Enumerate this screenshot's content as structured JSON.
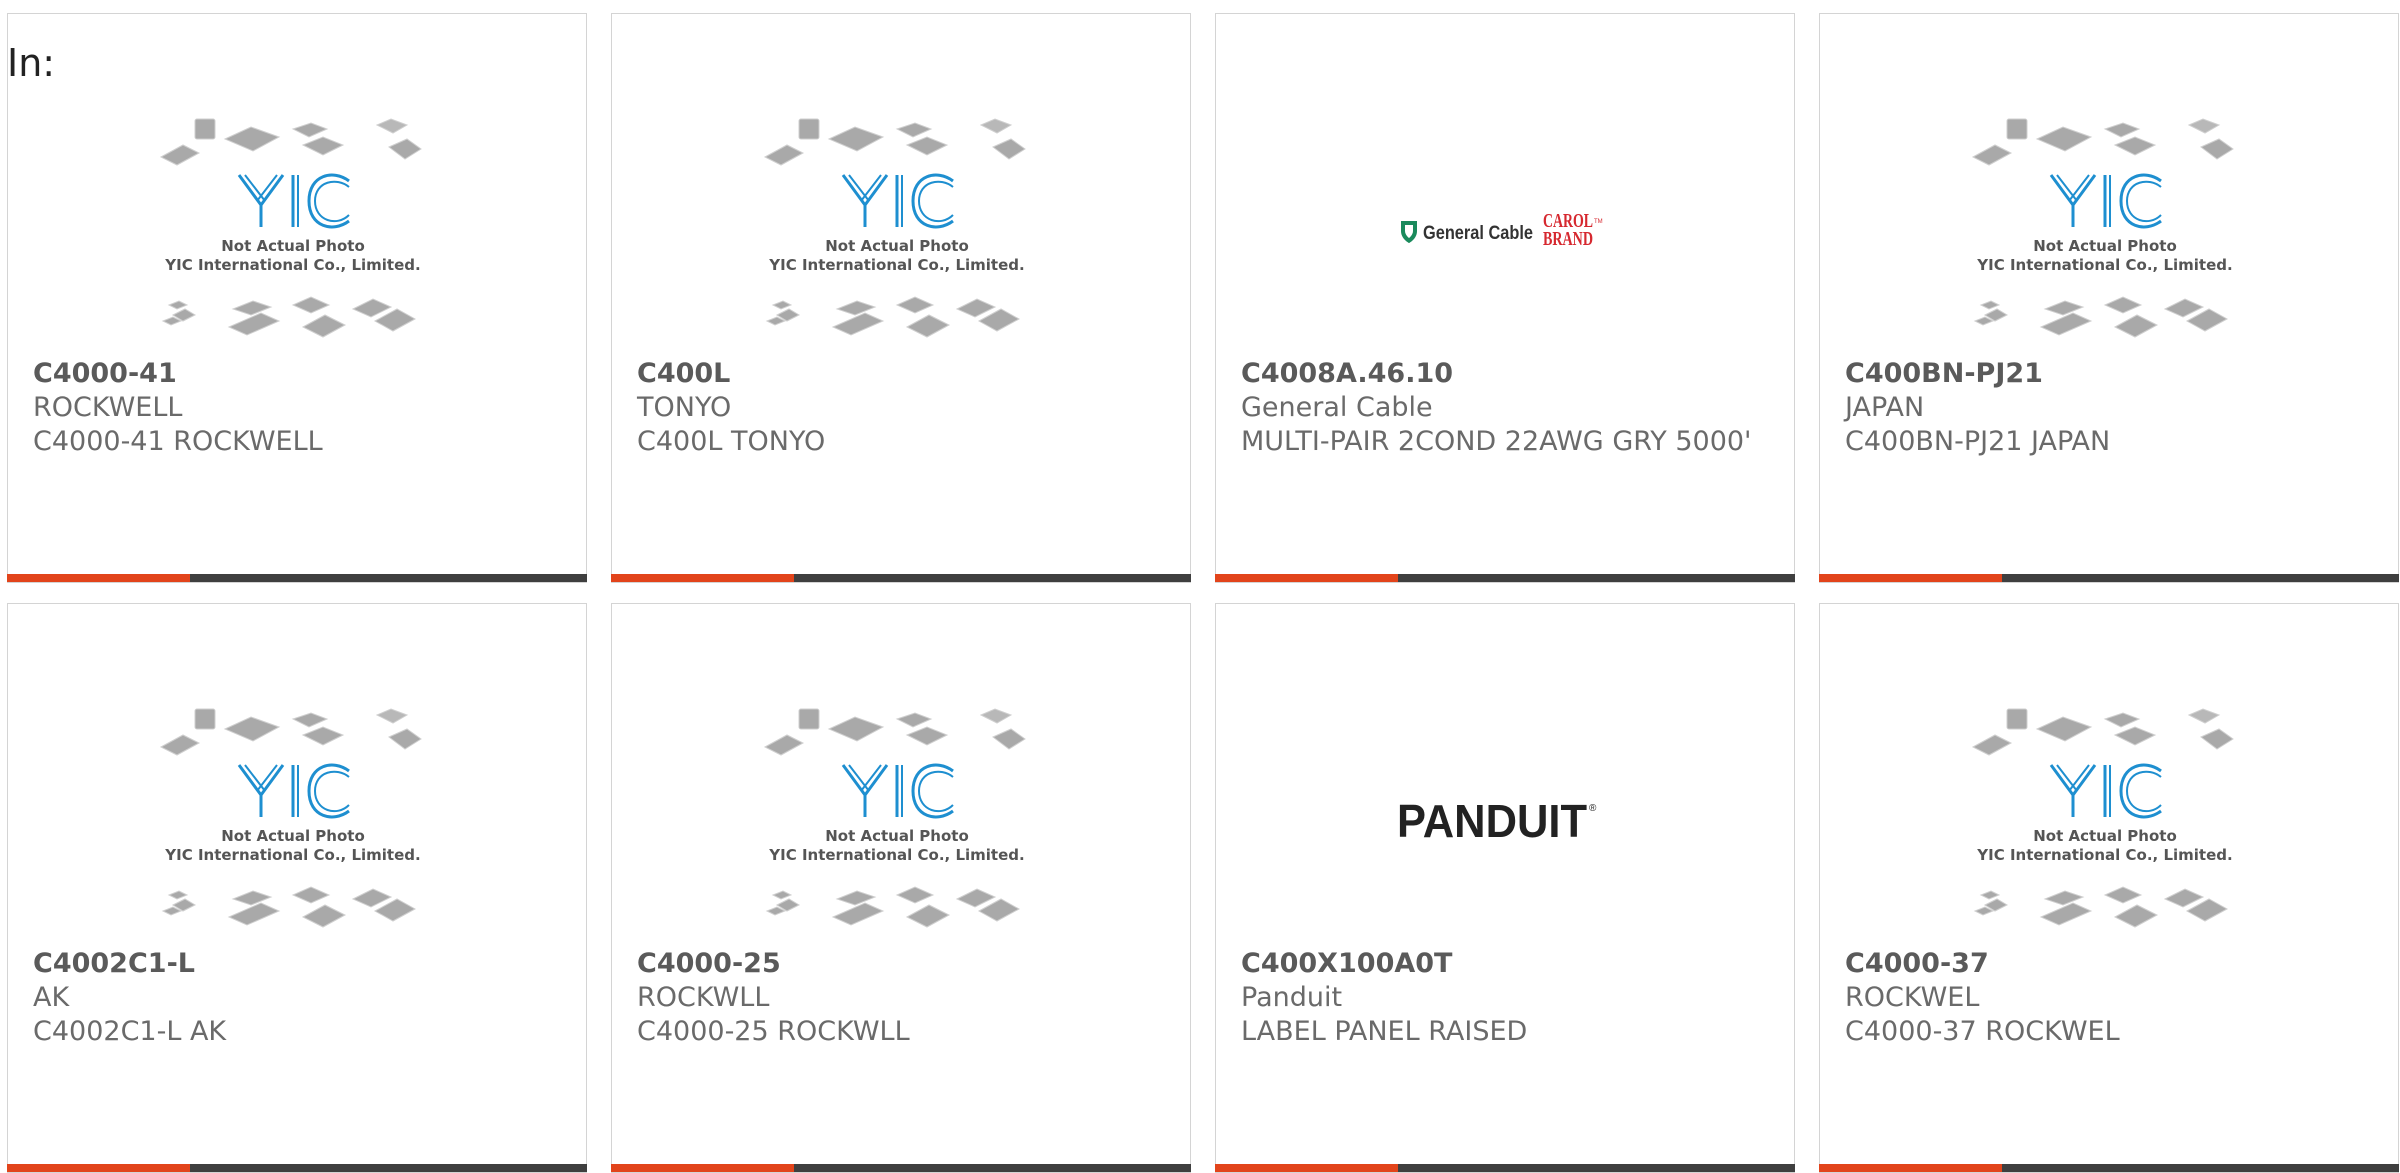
{
  "filter": {
    "label": "In:"
  },
  "colors": {
    "accent": "#e2441b",
    "bar": "#3f3f3f",
    "yic_blue": "#1e8fd0"
  },
  "placeholder": {
    "icon": "yic-logo-icon",
    "line1": "Not Actual Photo",
    "line2": "YIC International Co., Limited."
  },
  "logos": {
    "general_cable": {
      "text": "General Cable",
      "carol1": "CAROL",
      "carol2": "BRAND",
      "tm": "TM"
    },
    "panduit": {
      "text": "PANDUIT",
      "reg": "®"
    }
  },
  "products": [
    {
      "part": "C4000-41",
      "mfr": "ROCKWELL",
      "desc": "C4000-41 ROCKWELL",
      "image": "yic-placeholder"
    },
    {
      "part": "C400L",
      "mfr": "TONYO",
      "desc": "C400L TONYO",
      "image": "yic-placeholder"
    },
    {
      "part": "C4008A.46.10",
      "mfr": "General Cable",
      "desc": "MULTI-PAIR 2COND 22AWG GRY 5000'",
      "image": "general-cable-logo"
    },
    {
      "part": "C400BN-PJ21",
      "mfr": "JAPAN",
      "desc": "C400BN-PJ21 JAPAN",
      "image": "yic-placeholder"
    },
    {
      "part": "C4002C1-L",
      "mfr": "AK",
      "desc": "C4002C1-L AK",
      "image": "yic-placeholder"
    },
    {
      "part": "C4000-25",
      "mfr": "ROCKWLL",
      "desc": "C4000-25 ROCKWLL",
      "image": "yic-placeholder"
    },
    {
      "part": "C400X100A0T",
      "mfr": "Panduit",
      "desc": "LABEL PANEL RAISED",
      "image": "panduit-logo"
    },
    {
      "part": "C4000-37",
      "mfr": "ROCKWEL",
      "desc": "C4000-37 ROCKWEL",
      "image": "yic-placeholder"
    }
  ]
}
